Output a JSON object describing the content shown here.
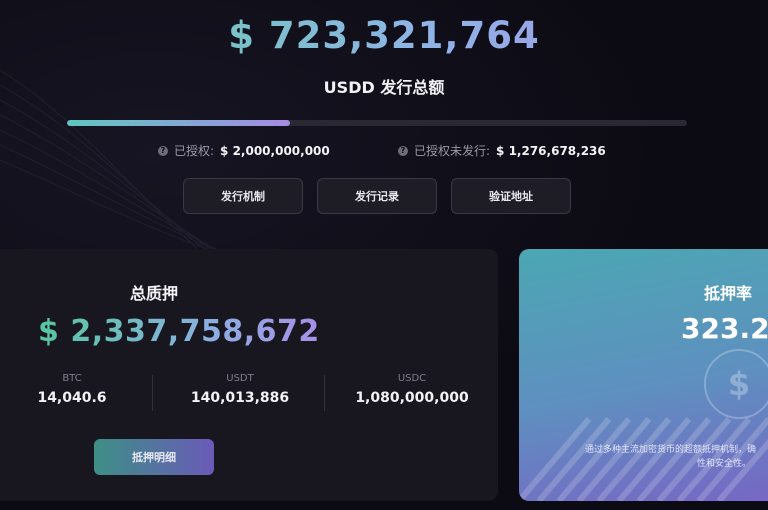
{
  "hero": {
    "total_issued": "$ 723,321,764",
    "title": "USDD 发行总额",
    "progress_fraction": 0.36
  },
  "stats": {
    "authorized_label": "已授权:",
    "authorized_value": "$ 2,000,000,000",
    "unissued_label": "已授权未发行:",
    "unissued_value": "$ 1,276,678,236"
  },
  "actions": {
    "mechanism": "发行机制",
    "records": "发行记录",
    "verify": "验证地址"
  },
  "collateral": {
    "title": "总质押",
    "total": "$ 2,337,758,672",
    "assets": [
      {
        "symbol": "BTC",
        "amount": "14,040.6"
      },
      {
        "symbol": "USDT",
        "amount": "140,013,886"
      },
      {
        "symbol": "USDC",
        "amount": "1,080,000,000"
      }
    ],
    "detail_button": "抵押明细"
  },
  "ratio_card": {
    "title": "抵押率",
    "value": "323.2",
    "desc_line1": "通过多种主流加密货币的超额抵押机制，确",
    "desc_line2": "性和安全性。"
  },
  "colors": {
    "accent_green": "#5fd1a3",
    "accent_purple": "#a88ee8",
    "background": "#0c0a12",
    "card": "#18171f"
  }
}
